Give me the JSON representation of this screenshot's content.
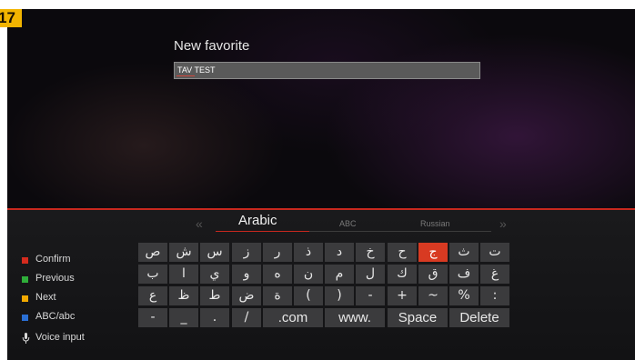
{
  "badge": "17",
  "dialog": {
    "title": "New favorite",
    "input_value": "TAV TEST"
  },
  "languages": {
    "prev_arrow": "«",
    "next_arrow": "»",
    "tabs": [
      "Arabic",
      "ABC",
      "Russian"
    ],
    "active": "Arabic"
  },
  "legend": [
    {
      "label": "Confirm",
      "color": "#d42b1e"
    },
    {
      "label": "Previous",
      "color": "#2fae3a"
    },
    {
      "label": "Next",
      "color": "#f2a900"
    },
    {
      "label": "ABC/abc",
      "color": "#2a6fd4"
    },
    {
      "label": "Voice input",
      "icon": "microphone-icon"
    }
  ],
  "keyboard": {
    "selected": "ج",
    "row1": [
      "ص",
      "ش",
      "س",
      "ز",
      "ر",
      "ذ",
      "د",
      "خ",
      "ح",
      "ج",
      "ث",
      "ت"
    ],
    "row2": [
      "ب",
      "ا",
      "ي",
      "و",
      "ه",
      "ن",
      "م",
      "ل",
      "ك",
      "ق",
      "ف",
      "غ"
    ],
    "row3": [
      "ع",
      "ظ",
      "ط",
      "ض",
      "ة",
      "(",
      ")",
      "-",
      "+",
      "~",
      "%",
      ":"
    ],
    "row4": [
      "-",
      "_",
      ".",
      "/",
      ".com",
      "www.",
      "Space",
      "Delete"
    ]
  }
}
